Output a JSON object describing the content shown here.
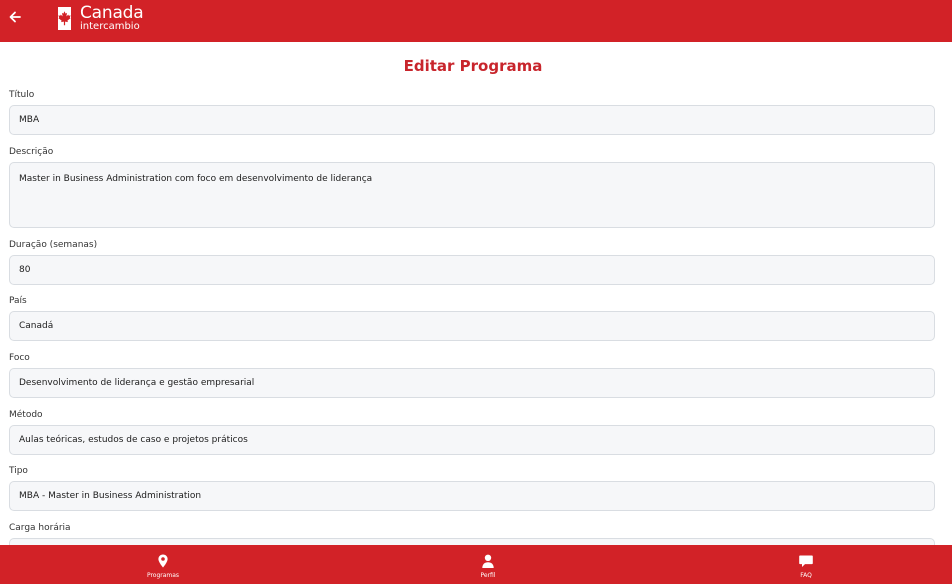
{
  "header": {
    "logo_main": "Canada",
    "logo_sub": "intercambio"
  },
  "page": {
    "title": "Editar Programa"
  },
  "form": {
    "titulo": {
      "label": "Título",
      "value": "MBA"
    },
    "descricao": {
      "label": "Descrição",
      "value": "Master in Business Administration com foco em desenvolvimento de liderança"
    },
    "duracao": {
      "label": "Duração (semanas)",
      "value": "80"
    },
    "pais": {
      "label": "País",
      "value": "Canadá"
    },
    "foco": {
      "label": "Foco",
      "value": "Desenvolvimento de liderança e gestão empresarial"
    },
    "metodo": {
      "label": "Método",
      "value": "Aulas teóricas, estudos de caso e projetos práticos"
    },
    "tipo": {
      "label": "Tipo",
      "value": "MBA - Master in Business Administration"
    },
    "carga": {
      "label": "Carga horária",
      "value": ""
    }
  },
  "nav": {
    "programas": {
      "label": "Programas",
      "icon": "map-pin-icon"
    },
    "perfil": {
      "label": "Perfil",
      "icon": "user-icon"
    },
    "faq": {
      "label": "FAQ",
      "icon": "chat-bubble-icon"
    }
  },
  "colors": {
    "brand_red": "#d22227",
    "title_red": "#c8252c",
    "field_bg": "#f6f7f9"
  }
}
